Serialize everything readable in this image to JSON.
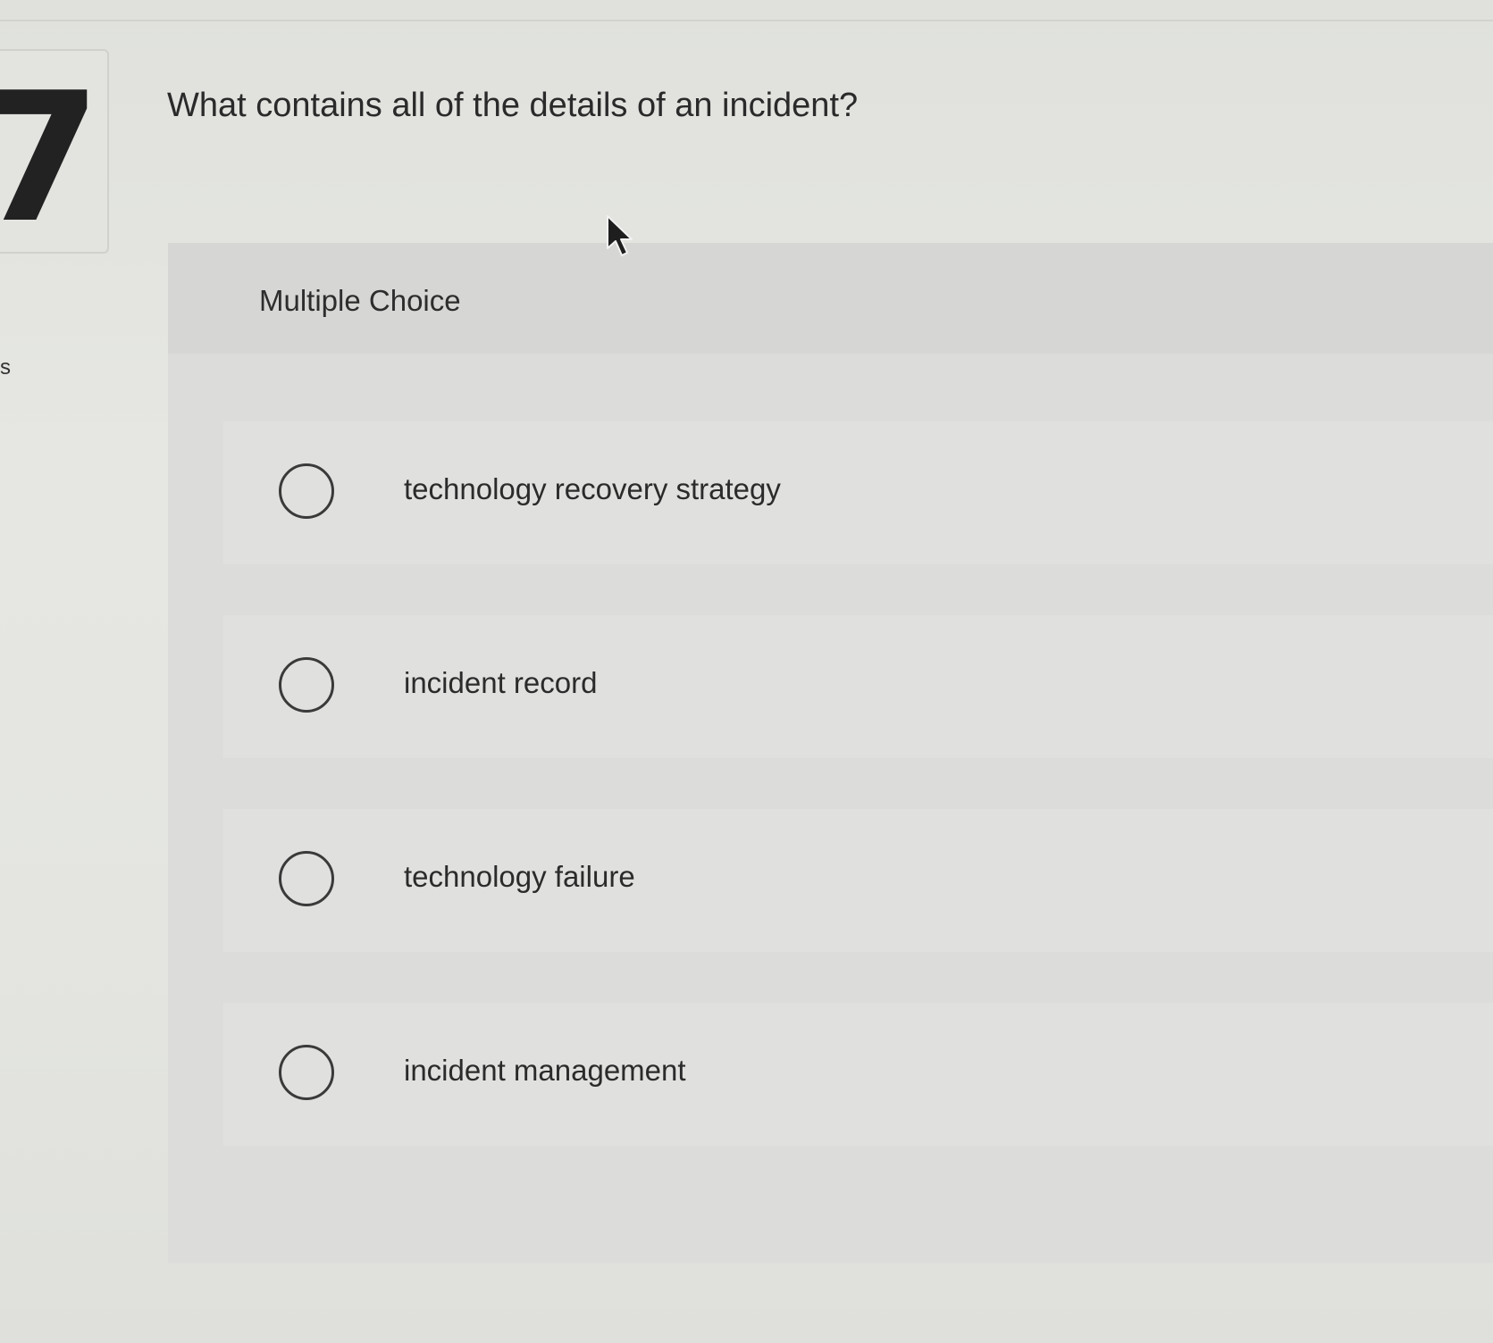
{
  "question": {
    "number": "7",
    "side_mark": "s",
    "text": "What contains all of the details of an incident?"
  },
  "question_type": "Multiple Choice",
  "options": [
    {
      "label": "technology recovery strategy",
      "selected": false
    },
    {
      "label": "incident record",
      "selected": false
    },
    {
      "label": "technology failure",
      "selected": false
    },
    {
      "label": "incident management",
      "selected": false
    }
  ]
}
